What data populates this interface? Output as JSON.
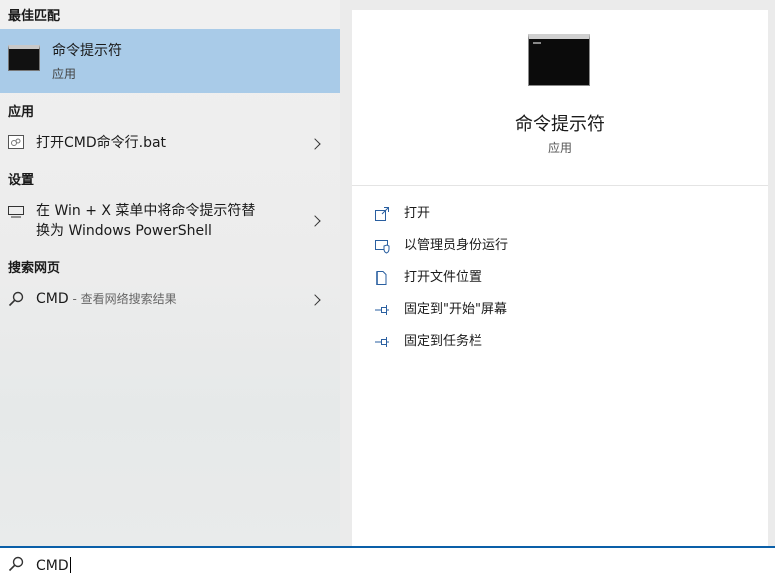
{
  "left": {
    "best_match": {
      "header": "最佳匹配",
      "name": "命令提示符",
      "type": "应用",
      "icon": "cmd-window-icon"
    },
    "apps": {
      "header": "应用",
      "items": [
        {
          "label": "打开CMD命令行.bat",
          "icon": "bat-file-icon"
        }
      ]
    },
    "settings": {
      "header": "设置",
      "items": [
        {
          "line1": "在 Win + X 菜单中将命令提示符替",
          "line2": "换为 Windows PowerShell",
          "icon": "monitor-icon"
        }
      ]
    },
    "web": {
      "header": "搜索网页",
      "items": [
        {
          "term": "CMD",
          "hint": " - 查看网络搜索结果",
          "icon": "search-icon"
        }
      ]
    }
  },
  "right": {
    "title": "命令提示符",
    "subtitle": "应用",
    "actions": [
      {
        "label": "打开",
        "icon": "open-icon"
      },
      {
        "label": "以管理员身份运行",
        "icon": "shield-admin-icon"
      },
      {
        "label": "打开文件位置",
        "icon": "file-location-icon"
      },
      {
        "label": "固定到\"开始\"屏幕",
        "icon": "pin-icon"
      },
      {
        "label": "固定到任务栏",
        "icon": "pin-icon"
      }
    ]
  },
  "search": {
    "value": "CMD"
  },
  "colors": {
    "selection": "#a9cbe8",
    "accent": "#0a5fa8",
    "pane_bg": "#ebebeb"
  }
}
